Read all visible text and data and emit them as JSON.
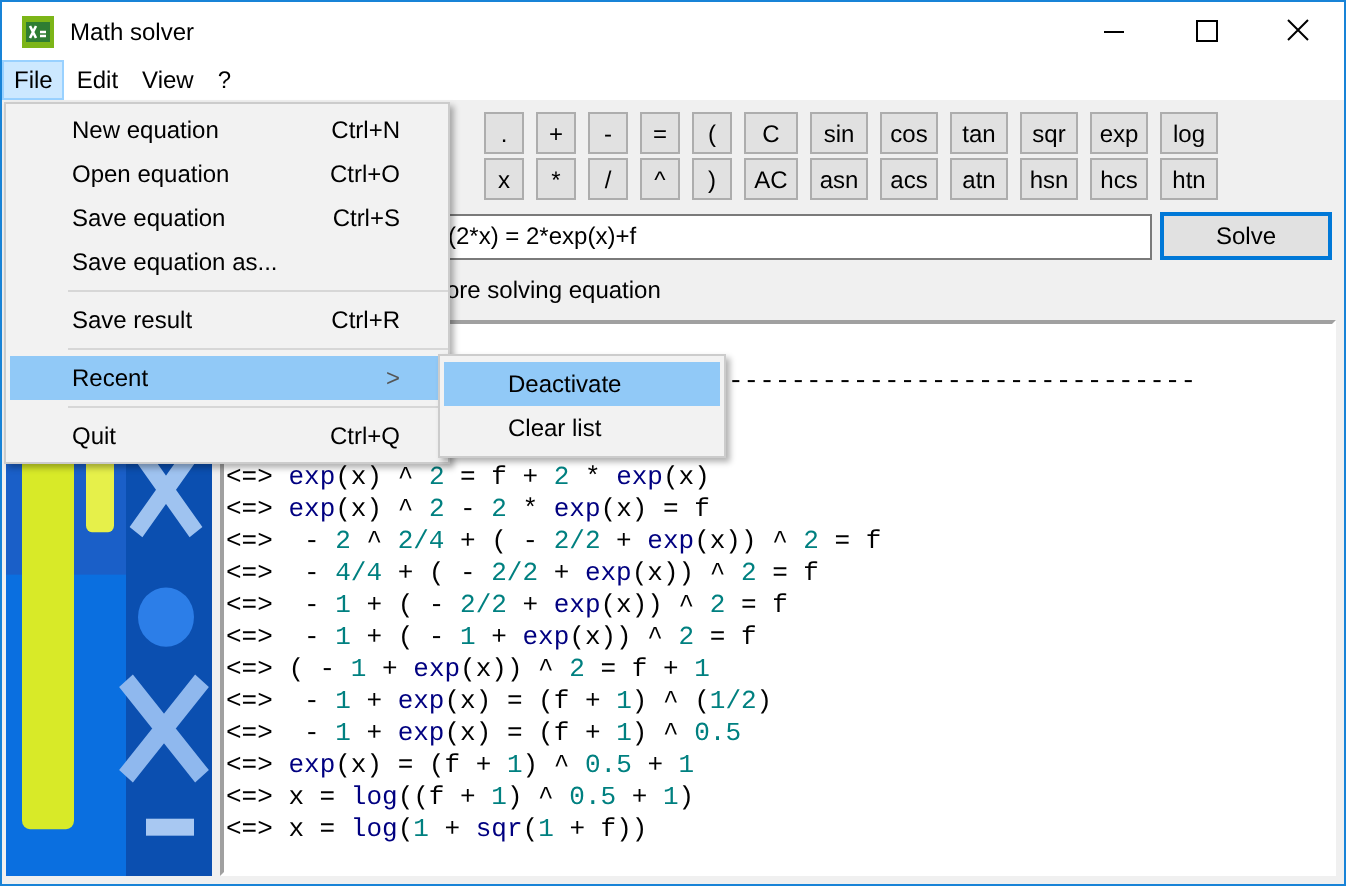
{
  "window": {
    "title": "Math solver"
  },
  "menu_bar": [
    {
      "label": "File",
      "selected": true
    },
    {
      "label": "Edit",
      "selected": false
    },
    {
      "label": "View",
      "selected": false
    },
    {
      "label": "?",
      "selected": false
    }
  ],
  "keypad": [
    [
      {
        "label": ".",
        "kind": "key"
      },
      {
        "label": "+",
        "kind": "key"
      },
      {
        "label": "-",
        "kind": "key"
      },
      {
        "label": "=",
        "kind": "key"
      },
      {
        "label": "(",
        "kind": "key"
      },
      {
        "label": "C",
        "kind": "wide"
      },
      {
        "label": "sin",
        "kind": "fn"
      },
      {
        "label": "cos",
        "kind": "fn"
      },
      {
        "label": "tan",
        "kind": "fn"
      },
      {
        "label": "sqr",
        "kind": "fn"
      },
      {
        "label": "exp",
        "kind": "fn"
      },
      {
        "label": "log",
        "kind": "fn"
      }
    ],
    [
      {
        "label": "x",
        "kind": "key"
      },
      {
        "label": "*",
        "kind": "key"
      },
      {
        "label": "/",
        "kind": "key"
      },
      {
        "label": "^",
        "kind": "key"
      },
      {
        "label": ")",
        "kind": "key"
      },
      {
        "label": "AC",
        "kind": "wide"
      },
      {
        "label": "asn",
        "kind": "fn"
      },
      {
        "label": "acs",
        "kind": "fn"
      },
      {
        "label": "atn",
        "kind": "fn"
      },
      {
        "label": "hsn",
        "kind": "fn"
      },
      {
        "label": "hcs",
        "kind": "fn"
      },
      {
        "label": "htn",
        "kind": "fn"
      }
    ]
  ],
  "equation": {
    "value": "(2*x) = 2*exp(x)+f"
  },
  "solve_button": "Solve",
  "option_label": "ore solving equation",
  "output": {
    "rule": "------------------------------",
    "lines": [
      "<=> exp(x) ^ 2 = f + 2 * exp(x)",
      "<=> exp(x) ^ 2 - 2 * exp(x) = f",
      "<=>  - 2 ^ 2/4 + ( - 2/2 + exp(x)) ^ 2 = f",
      "<=>  - 4/4 + ( - 2/2 + exp(x)) ^ 2 = f",
      "<=>  - 1 + ( - 2/2 + exp(x)) ^ 2 = f",
      "<=>  - 1 + ( - 1 + exp(x)) ^ 2 = f",
      "<=> ( - 1 + exp(x)) ^ 2 = f + 1",
      "<=>  - 1 + exp(x) = (f + 1) ^ (1/2)",
      "<=>  - 1 + exp(x) = (f + 1) ^ 0.5",
      "<=> exp(x) = (f + 1) ^ 0.5 + 1",
      "<=> x = log((f + 1) ^ 0.5 + 1)",
      "<=> x = log(1 + sqr(1 + f))"
    ]
  },
  "file_menu": [
    {
      "kind": "item",
      "label": "New equation",
      "shortcut": "Ctrl+N"
    },
    {
      "kind": "item",
      "label": "Open equation",
      "shortcut": "Ctrl+O"
    },
    {
      "kind": "item",
      "label": "Save equation",
      "shortcut": "Ctrl+S"
    },
    {
      "kind": "item",
      "label": "Save equation as..."
    },
    {
      "kind": "separator"
    },
    {
      "kind": "item",
      "label": "Save result",
      "shortcut": "Ctrl+R"
    },
    {
      "kind": "separator"
    },
    {
      "kind": "submenu",
      "label": "Recent",
      "arrow": ">",
      "selected": true
    },
    {
      "kind": "separator"
    },
    {
      "kind": "item",
      "label": "Quit",
      "shortcut": "Ctrl+Q"
    }
  ],
  "recent_menu": [
    {
      "label": "Deactivate",
      "selected": true
    },
    {
      "label": "Clear list",
      "selected": false
    }
  ]
}
